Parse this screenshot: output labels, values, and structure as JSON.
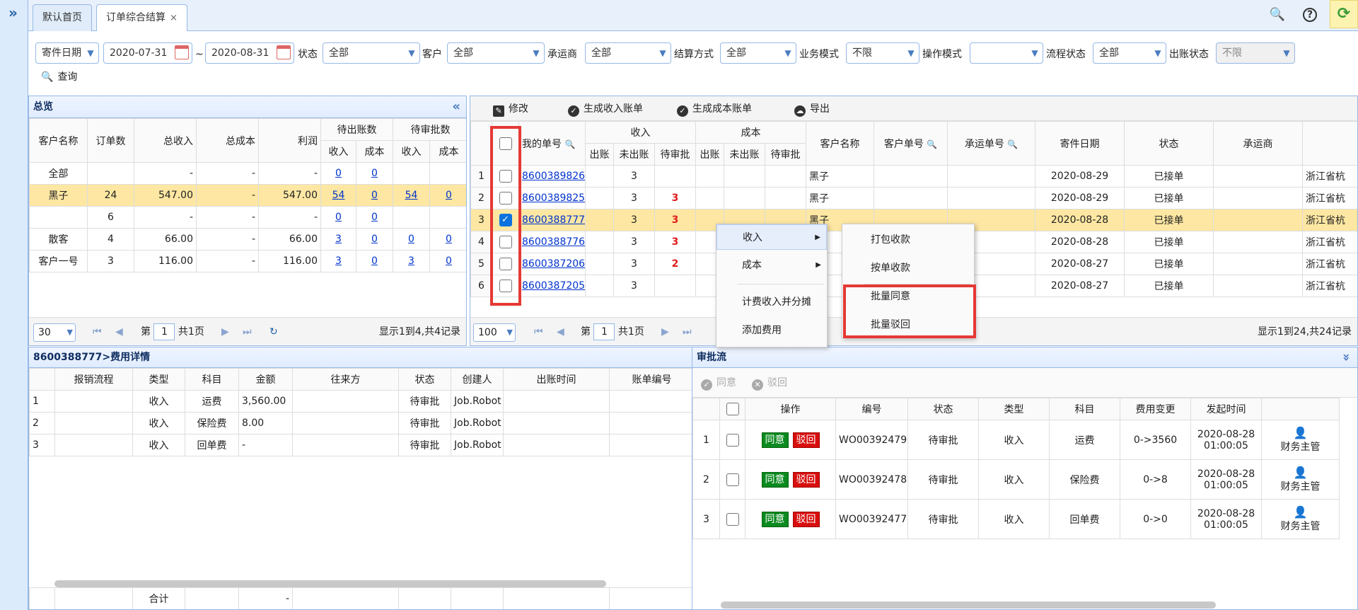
{
  "tabs": [
    {
      "label": "默认首页"
    },
    {
      "label": "订单综合结算",
      "close": "×"
    }
  ],
  "topicons": {
    "search": "🔍",
    "help": "?",
    "refresh": "⟳"
  },
  "filters": {
    "date_type": "寄件日期",
    "date_from": "2020-07-31",
    "date_sep": "~",
    "date_to": "2020-08-31",
    "status_label": "状态",
    "status_value": "全部",
    "customer_label": "客户",
    "customer_value": "全部",
    "carrier_label": "承运商",
    "carrier_value": "全部",
    "settle_label": "结算方式",
    "settle_value": "全部",
    "biz_label": "业务模式",
    "biz_value": "不限",
    "op_label": "操作模式",
    "op_value": "",
    "flow_label": "流程状态",
    "flow_value": "全部",
    "bill_label": "出账状态",
    "bill_value": "不限",
    "search": "查询"
  },
  "overview": {
    "title": "总览",
    "collapse": "«",
    "headers": {
      "customer": "客户名称",
      "orders": "订单数",
      "income": "总收入",
      "cost": "总成本",
      "profit": "利润",
      "pending_bill": "待出账数",
      "pending_approve": "待审批数",
      "in": "收入",
      "co": "成本"
    },
    "rows": [
      {
        "name": "全部",
        "orders": "",
        "income": "-",
        "cost": "-",
        "profit": "-",
        "pb_in": "0",
        "pb_co": "0",
        "pa_in": "",
        "pa_co": ""
      },
      {
        "name": "黑子",
        "orders": "24",
        "income": "547.00",
        "cost": "-",
        "profit": "547.00",
        "pb_in": "54",
        "pb_co": "0",
        "pa_in": "54",
        "pa_co": "0"
      },
      {
        "name": "",
        "orders": "6",
        "income": "-",
        "cost": "-",
        "profit": "-",
        "pb_in": "0",
        "pb_co": "0",
        "pa_in": "",
        "pa_co": ""
      },
      {
        "name": "散客",
        "orders": "4",
        "income": "66.00",
        "cost": "-",
        "profit": "66.00",
        "pb_in": "3",
        "pb_co": "0",
        "pa_in": "0",
        "pa_co": "0"
      },
      {
        "name": "客户一号",
        "orders": "3",
        "income": "116.00",
        "cost": "-",
        "profit": "116.00",
        "pb_in": "3",
        "pb_co": "0",
        "pa_in": "3",
        "pa_co": "0"
      }
    ],
    "pager": {
      "size": "30",
      "page_pre": "第",
      "page": "1",
      "page_post": "共1页",
      "info": "显示1到4,共4记录"
    }
  },
  "orders": {
    "toolbar": {
      "edit": "修改",
      "gen_income": "生成收入账单",
      "gen_cost": "生成成本账单",
      "export": "导出"
    },
    "headers": {
      "my_no": "我的单号",
      "income": "收入",
      "cost": "成本",
      "billed": "出账",
      "unbilled": "未出账",
      "pending": "待审批",
      "customer": "客户名称",
      "cust_no": "客户单号",
      "carrier_no": "承运单号",
      "date": "寄件日期",
      "status": "状态",
      "carrier": "承运商"
    },
    "rows": [
      {
        "n": "1",
        "no": "8600389826",
        "unbilled": "3",
        "pending": "",
        "cust": "黑子",
        "date": "2020-08-29",
        "status": "已接单",
        "carrier": "浙江省杭"
      },
      {
        "n": "2",
        "no": "8600389825",
        "unbilled": "3",
        "pending": "3",
        "cust": "黑子",
        "date": "2020-08-29",
        "status": "已接单",
        "carrier": "浙江省杭"
      },
      {
        "n": "3",
        "no": "8600388777",
        "unbilled": "3",
        "pending": "3",
        "cust": "黑子",
        "date": "2020-08-28",
        "status": "已接单",
        "carrier": "浙江省杭"
      },
      {
        "n": "4",
        "no": "8600388776",
        "unbilled": "3",
        "pending": "3",
        "cust": "",
        "date": "2020-08-28",
        "status": "已接单",
        "carrier": "浙江省杭"
      },
      {
        "n": "5",
        "no": "8600387206",
        "unbilled": "3",
        "pending": "2",
        "cust": "",
        "date": "2020-08-27",
        "status": "已接单",
        "carrier": "浙江省杭"
      },
      {
        "n": "6",
        "no": "8600387205",
        "unbilled": "3",
        "pending": "",
        "cust": "",
        "date": "2020-08-27",
        "status": "已接单",
        "carrier": "浙江省杭"
      }
    ],
    "pager": {
      "size": "100",
      "page_pre": "第",
      "page": "1",
      "page_post": "共1页",
      "info": "显示1到24,共24记录"
    }
  },
  "context_menu": {
    "income": "收入",
    "cost": "成本",
    "calc": "计费收入并分摊",
    "add_fee": "添加费用"
  },
  "submenu": {
    "pack": "打包收款",
    "by_order": "按单收款",
    "batch_agree": "批量同意",
    "batch_reject": "批量驳回"
  },
  "fee_detail": {
    "title": "8600388777>费用详情",
    "headers": {
      "flow": "报销流程",
      "type": "类型",
      "subject": "科目",
      "amount": "金额",
      "party": "往来方",
      "status": "状态",
      "creator": "创建人",
      "bill_time": "出账时间",
      "bill_no": "账单编号"
    },
    "rows": [
      {
        "n": "1",
        "type": "收入",
        "subject": "运费",
        "amount": "3,560.00",
        "status": "待审批",
        "creator": "Job.Robot"
      },
      {
        "n": "2",
        "type": "收入",
        "subject": "保险费",
        "amount": "8.00",
        "status": "待审批",
        "creator": "Job.Robot"
      },
      {
        "n": "3",
        "type": "收入",
        "subject": "回单费",
        "amount": "-",
        "status": "待审批",
        "creator": "Job.Robot"
      }
    ],
    "total_label": "合计",
    "total_amount": "-"
  },
  "approval": {
    "title": "审批流",
    "collapse": "»",
    "toolbar": {
      "agree": "同意",
      "reject": "驳回"
    },
    "headers": {
      "op": "操作",
      "no": "编号",
      "status": "状态",
      "type": "类型",
      "subject": "科目",
      "change": "费用变更",
      "time": "发起时间"
    },
    "btn_agree": "同意",
    "btn_reject": "驳回",
    "rows": [
      {
        "n": "1",
        "no": "WO00392479",
        "status": "待审批",
        "type": "收入",
        "subject": "运费",
        "change": "0->3560",
        "date": "2020-08-28",
        "time": "01:00:05",
        "user": "财务主管"
      },
      {
        "n": "2",
        "no": "WO00392478",
        "status": "待审批",
        "type": "收入",
        "subject": "保险费",
        "change": "0->8",
        "date": "2020-08-28",
        "time": "01:00:05",
        "user": "财务主管"
      },
      {
        "n": "3",
        "no": "WO00392477",
        "status": "待审批",
        "type": "收入",
        "subject": "回单费",
        "change": "0->0",
        "date": "2020-08-28",
        "time": "01:00:05",
        "user": "财务主管"
      }
    ]
  }
}
